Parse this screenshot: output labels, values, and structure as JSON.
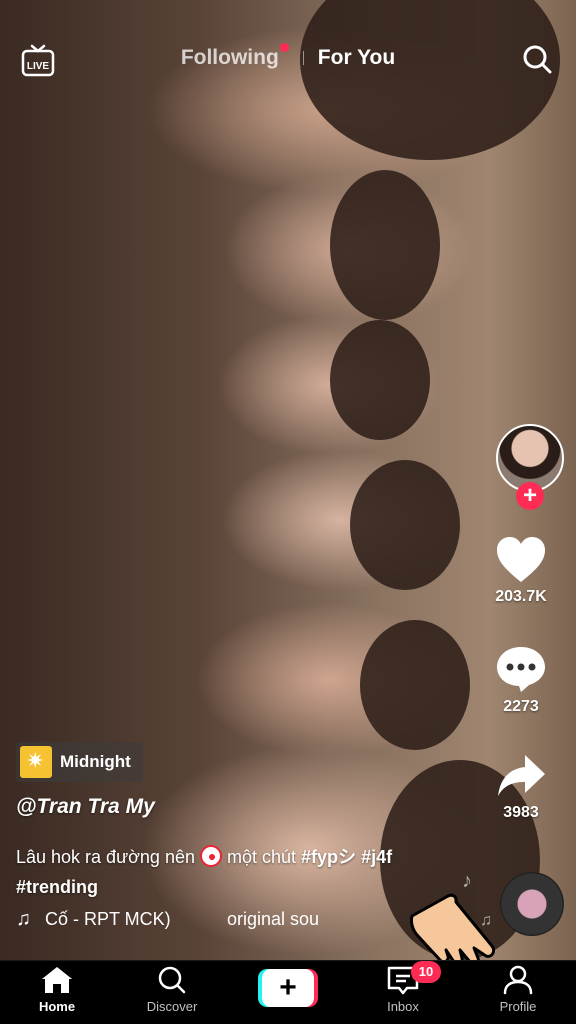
{
  "topbar": {
    "live_icon": "live-icon",
    "tabs": {
      "following": "Following",
      "for_you": "For You"
    },
    "search_icon": "search-icon"
  },
  "rail": {
    "likes": "203.7K",
    "comments": "2273",
    "shares": "3983"
  },
  "video": {
    "effect_label": "Midnight",
    "username": "@Tran Tra My",
    "caption_text": "Lâu hok ra đường nên",
    "caption_after_emoji": " một chút ",
    "hashtags": [
      "#fypシ",
      "#j4f",
      "#trending"
    ],
    "music_part1": "Cố - RPT MCK)",
    "music_part2": "original sou"
  },
  "bottom_nav": {
    "home": "Home",
    "discover": "Discover",
    "inbox": "Inbox",
    "inbox_badge": "10",
    "profile": "Profile"
  },
  "colors": {
    "accent_red": "#fe2c55",
    "accent_cyan": "#25f4ee"
  }
}
